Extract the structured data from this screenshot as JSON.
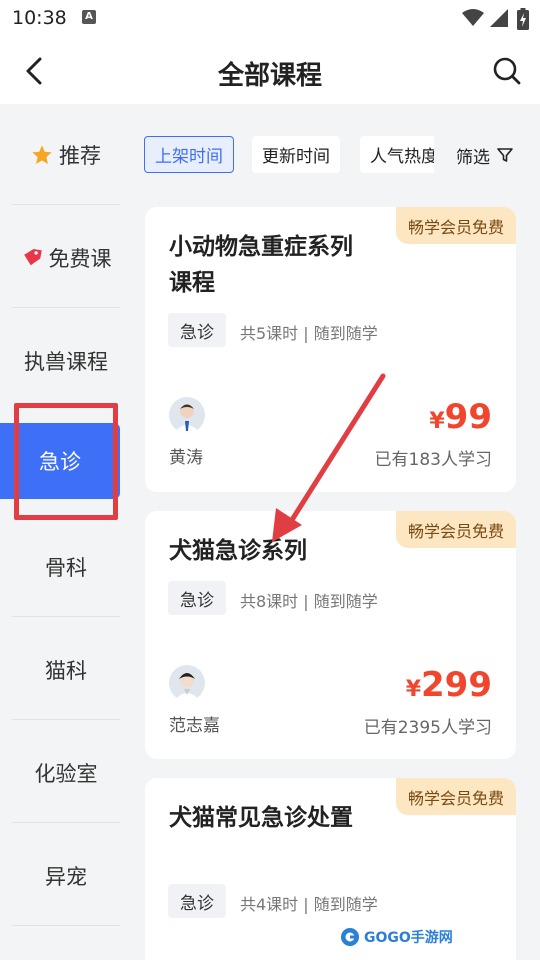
{
  "status_bar": {
    "time": "10:38",
    "icons": [
      "a-notification-icon",
      "wifi-icon",
      "signal-icon",
      "battery-icon"
    ]
  },
  "header": {
    "title": "全部课程",
    "back_icon": "chevron-left-icon",
    "search_icon": "search-icon"
  },
  "sidebar": {
    "items": [
      {
        "label": "推荐",
        "icon": "star-icon"
      },
      {
        "label": "免费课",
        "icon": "tag-icon"
      },
      {
        "label": "执兽课程"
      },
      {
        "label": "急诊",
        "active": true
      },
      {
        "label": "骨科"
      },
      {
        "label": "猫科"
      },
      {
        "label": "化验室"
      },
      {
        "label": "异宠"
      }
    ]
  },
  "sort_tabs": [
    {
      "label": "上架时间",
      "active": true
    },
    {
      "label": "更新时间"
    },
    {
      "label": "人气热度"
    }
  ],
  "filter": {
    "label": "筛选",
    "icon": "filter-funnel-icon"
  },
  "courses": [
    {
      "badge": "畅学会员免费",
      "title": "小动物急重症系列课程",
      "tag": "急诊",
      "lessons": "共5课时 | 随到随学",
      "teacher": "黄涛",
      "price_symbol": "¥",
      "price": "99",
      "learners": "已有183人学习"
    },
    {
      "badge": "畅学会员免费",
      "title": "犬猫急诊系列",
      "tag": "急诊",
      "lessons": "共8课时 | 随到随学",
      "teacher": "范志嘉",
      "price_symbol": "¥",
      "price": "299",
      "learners": "已有2395人学习"
    },
    {
      "badge": "畅学会员免费",
      "title": "犬猫常见急诊处置",
      "tag": "急诊",
      "lessons": "共4课时 | 随到随学"
    }
  ],
  "watermark": {
    "text": "GOGO手游网"
  },
  "colors": {
    "accent": "#3d6ff7",
    "price": "#f2452d",
    "badge_bg": "#fde7c3",
    "annotation": "#e03e43"
  }
}
